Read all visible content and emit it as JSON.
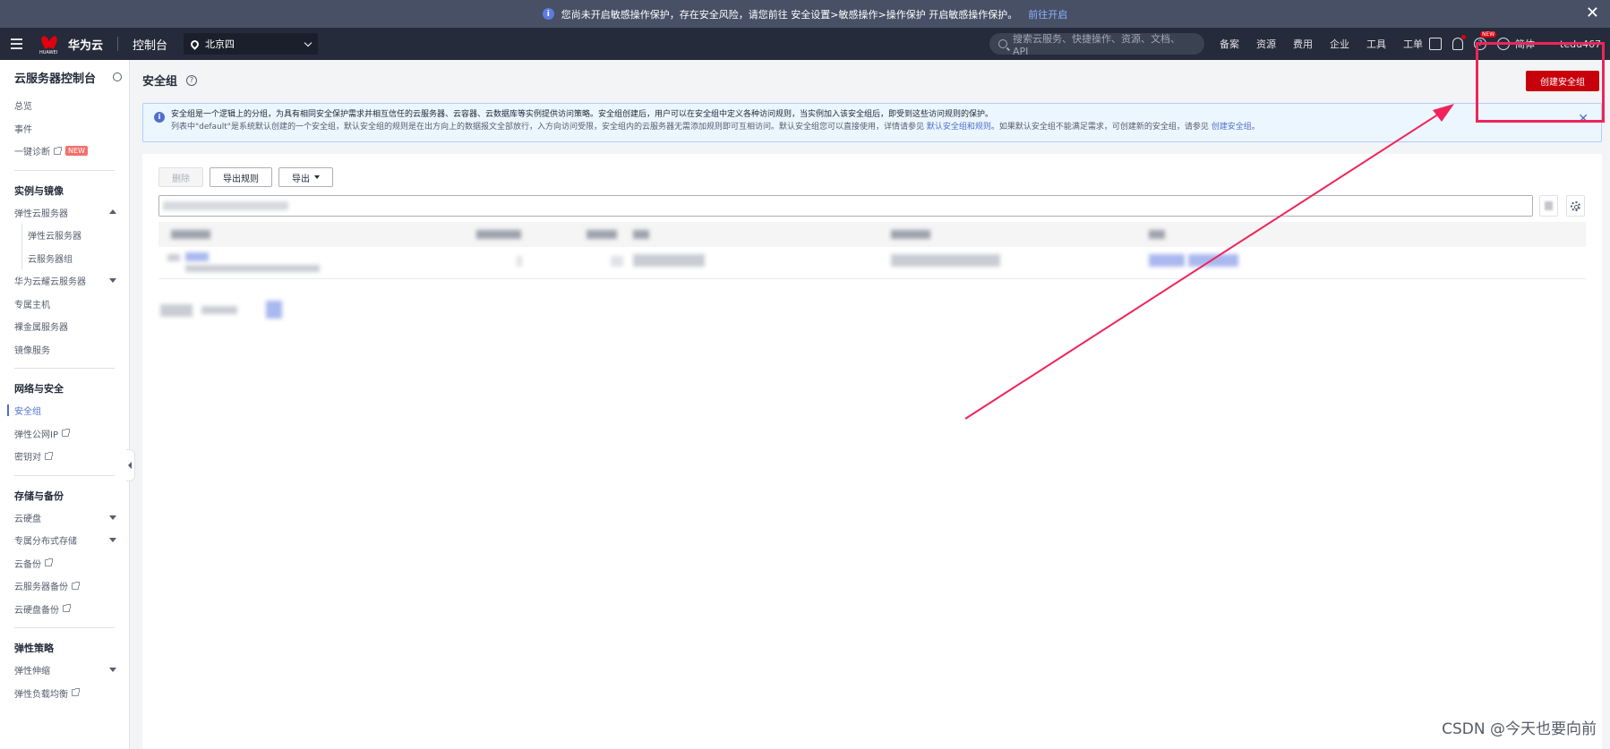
{
  "banner": {
    "text": "您尚未开启敏感操作保护，存在安全风险，请您前往 安全设置>敏感操作>操作保护 开启敏感操作保护。",
    "link": "前往开启",
    "info_glyph": "i",
    "close_glyph": "✕"
  },
  "nav": {
    "brand_small": "HUAWEI",
    "brand": "华为云",
    "console": "控制台",
    "region": "北京四",
    "search_placeholder": "搜索云服务、快捷操作、资源、文档、API",
    "links": [
      "备案",
      "资源",
      "费用",
      "企业",
      "工具",
      "工单"
    ],
    "new_badge": "NEW",
    "help_glyph": "?",
    "lang": "简体",
    "user": "tedu467"
  },
  "sidebar": {
    "title": "云服务器控制台",
    "top_items": [
      {
        "label": "总览"
      },
      {
        "label": "事件"
      },
      {
        "label": "一键诊断",
        "tag": "NEW"
      }
    ],
    "groups": [
      {
        "title": "实例与镜像",
        "items": [
          "弹性云服务器",
          "弹性云服务器",
          "云服务器组",
          "华为云耀云服务器",
          "专属主机",
          "裸金属服务器",
          "镜像服务"
        ]
      },
      {
        "title": "网络与安全",
        "items": [
          "安全组",
          "弹性公网IP",
          "密钥对"
        ]
      },
      {
        "title": "存储与备份",
        "items": [
          "云硬盘",
          "专属分布式存储",
          "云备份",
          "云服务器备份",
          "云硬盘备份"
        ]
      },
      {
        "title": "弹性策略",
        "items": [
          "弹性伸缩",
          "弹性负载均衡"
        ]
      }
    ]
  },
  "main": {
    "title": "安全组",
    "title_help": "?",
    "create_button": "创建安全组",
    "info": {
      "glyph": "i",
      "line1": "安全组是一个逻辑上的分组，为具有相同安全保护需求并相互信任的云服务器、云容器、云数据库等实例提供访问策略。安全组创建后，用户可以在安全组中定义各种访问规则，当实例加入该安全组后，即受到这些访问规则的保护。",
      "line2_prefix": "列表中\"default\"是系统默认创建的一个安全组，默认安全组的规则是在出方向上的数据报文全部放行，入方向访问受限，安全组内的云服务器无需添加规则即可互相访问。默认安全组您可以直接使用，详情请参见 ",
      "line2_link1": "默认安全组和规则",
      "line2_mid": "。如果默认安全组不能满足需求，可创建新的安全组，请参见 ",
      "line2_link2": "创建安全组",
      "line2_suffix": "。",
      "close_glyph": "✕"
    },
    "toolbar": {
      "delete": "删除",
      "export_rules": "导出规则",
      "export": "导出"
    }
  },
  "watermark": "CSDN @今天也要向前"
}
